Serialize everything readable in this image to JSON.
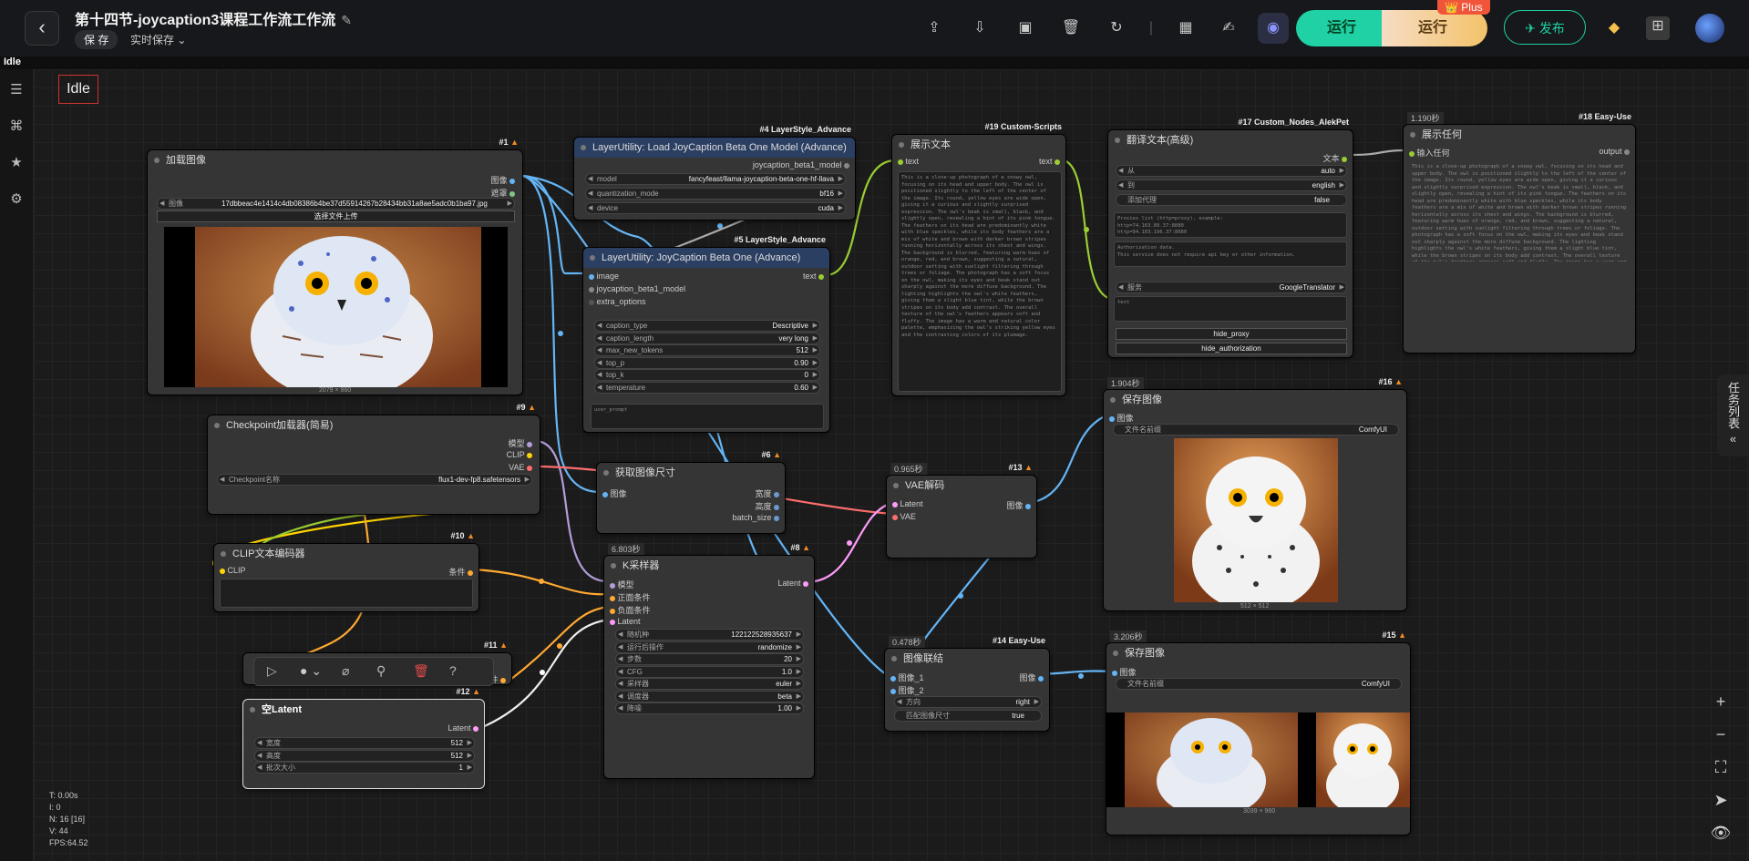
{
  "header": {
    "back_label": "‹",
    "title": "第十四节-joycaption3课程工作流工作流",
    "save_label": "保 存",
    "autosave_label": "实时保存",
    "run_label": "运行",
    "run_pro_label": "运行",
    "plus_label": "Plus",
    "publish_label": "发布"
  },
  "menubar": {
    "status": "Idle"
  },
  "canvas_status": {
    "idle": "Idle",
    "t": "T: 0.00s",
    "i": "I: 0",
    "n": "N: 16 [16]",
    "v": "V: 44",
    "fps": "FPS:64.52"
  },
  "task_panel": {
    "label": "任务列表"
  },
  "nodes": {
    "load_image": {
      "badge": "#1",
      "title": "加载图像",
      "out_image": "图像",
      "out_mask": "遮罩",
      "image_label": "图像",
      "image_value": "17dbbeac4e1414c4db08386b4be37d55914267b28434bb31a8ae5adc0b1ba97.jpg",
      "upload_label": "选择文件上传",
      "size": "2079 × 960"
    },
    "load_model": {
      "badge": "#4 LayerStyle_Advance",
      "title": "LayerUtility: Load JoyCaption Beta One Model (Advance)",
      "out": "joycaption_beta1_model",
      "w1_label": "model",
      "w1_value": "fancyfeast/llama-joycaption-beta-one-hf-llava",
      "w2_label": "quantization_mode",
      "w2_value": "bf16",
      "w3_label": "device",
      "w3_value": "cuda"
    },
    "joycaption": {
      "badge": "#5 LayerStyle_Advance",
      "title": "LayerUtility: JoyCaption Beta One (Advance)",
      "in1": "image",
      "in2": "joycaption_beta1_model",
      "in3": "extra_options",
      "out": "text",
      "widgets": [
        {
          "label": "caption_type",
          "value": "Descriptive"
        },
        {
          "label": "caption_length",
          "value": "very long"
        },
        {
          "label": "max_new_tokens",
          "value": "512"
        },
        {
          "label": "top_p",
          "value": "0.90"
        },
        {
          "label": "top_k",
          "value": "0"
        },
        {
          "label": "temperature",
          "value": "0.60"
        }
      ],
      "prompt_placeholder": "user_prompt"
    },
    "show_text": {
      "badge": "#19 Custom-Scripts",
      "title": "展示文本",
      "in": "text",
      "out": "text",
      "content": "This is a close-up photograph of a snowy owl, focusing on its head and upper body. The owl is positioned slightly to the left of the center of the image. Its round, yellow eyes are wide open, giving it a curious and slightly surprised expression. The owl's beak is small, black, and slightly open, revealing a hint of its pink tongue. The feathers on its head are predominantly white with blue speckles, while its body feathers are a mix of white and brown with darker brown stripes running horizontally across its chest and wings. The background is blurred, featuring warm hues of orange, red, and brown, suggesting a natural, outdoor setting with sunlight filtering through trees or foliage. The photograph has a soft focus on the owl, making its eyes and beak stand out sharply against the more diffuse background. The lighting highlights the owl's white feathers, giving them a slight blue tint, while the brown stripes on its body add contrast. The overall texture of the owl's feathers appears soft and fluffy. The image has a warm and natural color palette, emphasizing the owl's striking yellow eyes and the contrasting colors of its plumage."
    },
    "translate": {
      "badge": "#17 Custom_Nodes_AlekPet",
      "title": "翻译文本(高级)",
      "out": "文本",
      "w1_label": "从",
      "w1_value": "auto",
      "w2_label": "到",
      "w2_value": "english",
      "w3_label": "添加代理",
      "w3_value": "false",
      "proxy_text": "Proxies list (http=proxy), example:\nhttp=74.163.89.37:8080\nhttp=94.103.196.37:8080",
      "auth_text": "Authorization data.\nThis service does not require api key or other information.",
      "service_label": "服务",
      "service_value": "GoogleTranslator",
      "input_placeholder": "text",
      "btn1": "hide_proxy",
      "btn2": "hide_authorization"
    },
    "show_any": {
      "time": "1.190秒",
      "badge": "#18 Easy-Use",
      "title": "展示任何",
      "in": "输入任何",
      "out": "output"
    },
    "checkpoint": {
      "badge": "#9",
      "title": "Checkpoint加载器(简易)",
      "out1": "模型",
      "out2": "CLIP",
      "out3": "VAE",
      "w_label": "Checkpoint名称",
      "w_value": "flux1-dev-fp8.safetensors"
    },
    "image_size": {
      "badge": "#6",
      "title": "获取图像尺寸",
      "in": "图像",
      "out1": "宽度",
      "out2": "高度",
      "out3": "batch_size"
    },
    "vae_decode": {
      "time": "0.965秒",
      "badge": "#13",
      "title": "VAE解码",
      "in1": "Latent",
      "in2": "VAE",
      "out": "图像"
    },
    "save1": {
      "time": "1.904秒",
      "badge": "#16",
      "title": "保存图像",
      "in": "图像",
      "w_label": "文件名前缀",
      "w_value": "ComfyUI",
      "size": "512 × 512"
    },
    "clip_encode": {
      "badge": "#10",
      "title": "CLIP文本编码器",
      "in": "CLIP",
      "out": "条件"
    },
    "node11": {
      "badge": "#11",
      "out": "条件"
    },
    "ksampler": {
      "time": "6.803秒",
      "badge": "#8",
      "title": "K采样器",
      "in1": "模型",
      "in2": "正面条件",
      "in3": "负面条件",
      "in4": "Latent",
      "out": "Latent",
      "widgets": [
        {
          "label": "随机种",
          "value": "122122528935637"
        },
        {
          "label": "运行后操作",
          "value": "randomize"
        },
        {
          "label": "步数",
          "value": "20"
        },
        {
          "label": "CFG",
          "value": "1.0"
        },
        {
          "label": "采样器",
          "value": "euler"
        },
        {
          "label": "调度器",
          "value": "beta"
        },
        {
          "label": "降噪",
          "value": "1.00"
        }
      ]
    },
    "empty_latent": {
      "badge": "#12",
      "title": "空Latent",
      "out": "Latent",
      "widgets": [
        {
          "label": "宽度",
          "value": "512"
        },
        {
          "label": "高度",
          "value": "512"
        },
        {
          "label": "批次大小",
          "value": "1"
        }
      ]
    },
    "image_concat": {
      "time": "0.478秒",
      "badge": "#14 Easy-Use",
      "title": "图像联结",
      "in1": "图像_1",
      "in2": "图像_2",
      "out": "图像",
      "w1_label": "方向",
      "w1_value": "right",
      "w2_label": "匹配图像尺寸",
      "w2_value": "true"
    },
    "save2": {
      "time": "3.206秒",
      "badge": "#15",
      "title": "保存图像",
      "in": "图像",
      "w_label": "文件名前缀",
      "w_value": "ComfyUI",
      "size": "3039 × 960"
    }
  },
  "colors": {
    "accent": "#1fd1a5",
    "link_image": "#64b5f6",
    "link_clip": "#ffd500",
    "link_vae": "#ff6e6e",
    "link_model": "#b39ddb",
    "link_conditioning": "#ffa931",
    "link_latent": "#ff9cf9",
    "link_text": "#9acd32"
  }
}
